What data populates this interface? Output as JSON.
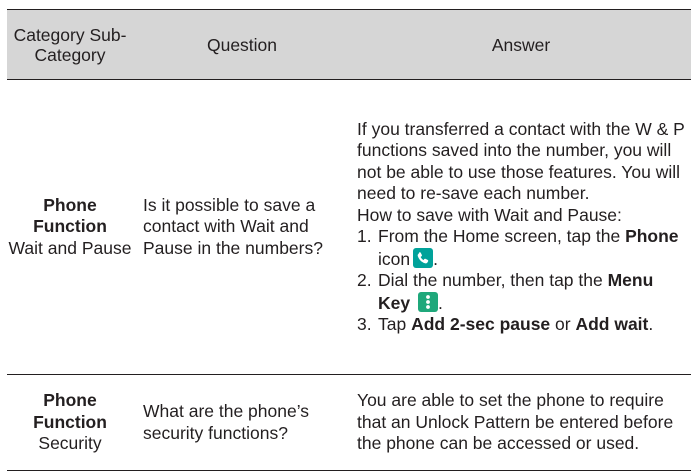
{
  "table": {
    "headers": {
      "category": "Category Sub-Category",
      "question": "Question",
      "answer": "Answer"
    },
    "rows": [
      {
        "category_main": "Phone Function",
        "category_sub": "Wait and Pause",
        "question": "Is it possible to save a contact with Wait and Pause in the numbers?",
        "answer_intro": "If you transferred a contact with the W & P functions saved into the number, you will not be able to use those features. You will need to re-save each number.",
        "answer_howto": "How to save with Wait and Pause:",
        "steps": [
          {
            "num": "1.",
            "pre": "From the Home screen, tap the ",
            "bold": "Phone",
            "post": " icon",
            "icon": "phone-app-icon",
            "end": "."
          },
          {
            "num": "2.",
            "pre": "Dial the number, then tap the ",
            "bold": "Menu Key",
            "post": " ",
            "icon": "menu-key-icon",
            "end": "."
          },
          {
            "num": "3.",
            "pre": "Tap ",
            "bold": "Add 2-sec pause",
            "mid": " or ",
            "bold2": "Add wait",
            "end": "."
          }
        ]
      },
      {
        "category_main": "Phone Function",
        "category_sub": "Security",
        "question": "What are the phone’s security functions?",
        "answer": "You are able to set the phone to require that an Unlock Pattern be entered before the phone can be accessed or used."
      }
    ]
  }
}
